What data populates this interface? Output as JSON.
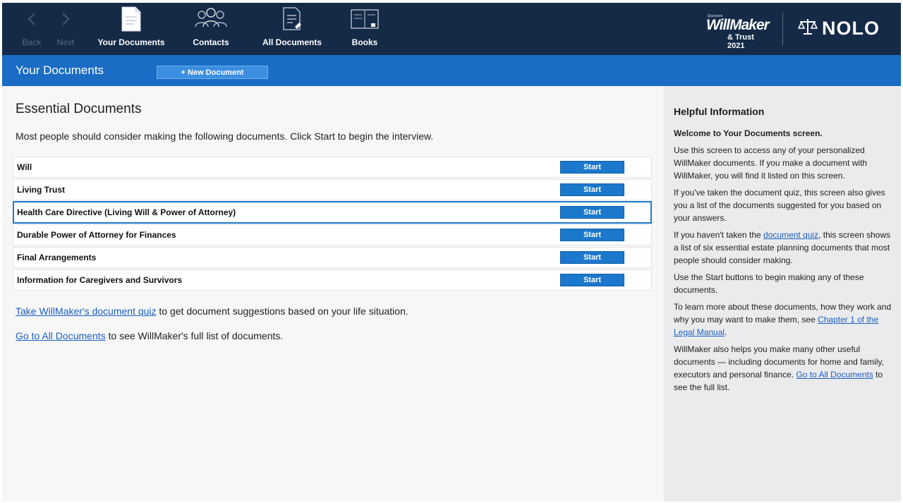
{
  "toolbar": {
    "back_label": "Back",
    "next_label": "Next",
    "your_documents_label": "Your Documents",
    "contacts_label": "Contacts",
    "all_documents_label": "All Documents",
    "books_label": "Books",
    "brand": {
      "small": "Quicken",
      "main": "WillMaker",
      "sub": "& Trust 2021"
    },
    "nolo": "NOLO"
  },
  "subheader": {
    "title": "Your Documents",
    "new_document_label": "+ New Document"
  },
  "main": {
    "title": "Essential Documents",
    "intro": "Most people should consider making the following documents. Click Start to begin the interview.",
    "start_label": "Start",
    "documents": [
      {
        "name": "Will"
      },
      {
        "name": "Living Trust"
      },
      {
        "name": "Health Care Directive (Living Will & Power of Attorney)"
      },
      {
        "name": "Durable Power of Attorney for Finances"
      },
      {
        "name": "Final Arrangements"
      },
      {
        "name": "Information for Caregivers and Survivors"
      }
    ],
    "selected_document": "Health Care Directive (Living Will & Power of Attorney)",
    "quiz_link": "Take WillMaker's document quiz",
    "quiz_suffix": " to get document suggestions based on your life situation.",
    "all_docs_link": "Go to All Documents",
    "all_docs_suffix": " to see WillMaker's full list of documents."
  },
  "side": {
    "title": "Helpful Information",
    "welcome": "Welcome to Your Documents screen.",
    "p1": "Use this screen to access any of your personalized WillMaker documents. If you make a document with WillMaker, you will find it listed on this screen.",
    "p2": "If you've taken the document quiz, this screen also gives you a list of the documents suggested for you based on your answers.",
    "p3_prefix": "If you haven't taken the ",
    "p3_link": "document quiz",
    "p3_suffix": ", this screen shows a list of six essential estate planning documents that most people should consider making.",
    "p4": "Use the Start buttons to begin making any of these documents.",
    "p5_prefix": "To learn more about these documents, how they work and why you may want to make them, see ",
    "p5_link": "Chapter 1 of the Legal Manual",
    "p5_suffix": ".",
    "p6_prefix": "WillMaker also helps you make many other useful documents — including documents for home and family, executors and personal finance. ",
    "p6_link": "Go to All Documents",
    "p6_suffix": " to see the full list."
  },
  "colors": {
    "toolbar_bg": "#142a47",
    "subheader_bg": "#1a6cc4",
    "start_button": "#1b78cc",
    "link": "#1a5fc2",
    "selected_border": "#1e79c9"
  },
  "icons": {
    "back": "chevron-left-icon",
    "next": "chevron-right-icon",
    "your_documents": "document-icon",
    "contacts": "people-icon",
    "all_documents": "documents-list-icon",
    "books": "book-icon",
    "nolo": "scales-icon"
  }
}
